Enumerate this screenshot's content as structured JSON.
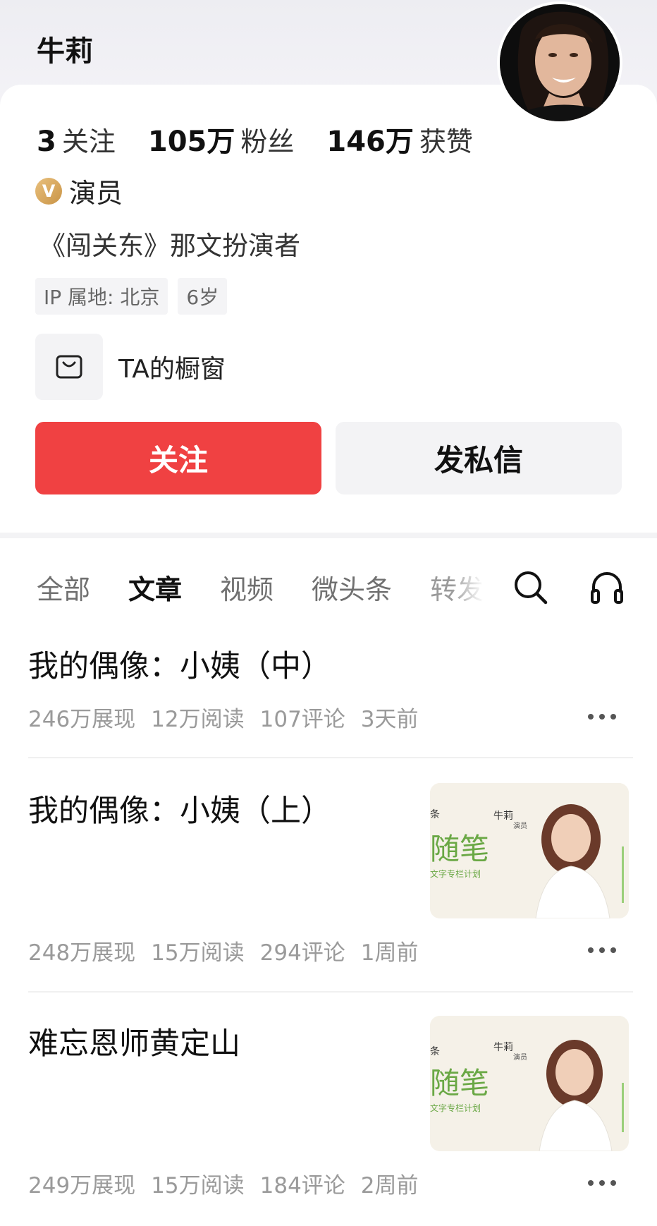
{
  "profile": {
    "name": "牛莉",
    "stats": [
      {
        "num": "3",
        "label": "关注"
      },
      {
        "num": "105万",
        "label": "粉丝"
      },
      {
        "num": "146万",
        "label": "获赞"
      }
    ],
    "verify_badge": "V",
    "verify_text": "演员",
    "bio": "《闯关东》那文扮演者",
    "tags": [
      "IP 属地: 北京",
      "6岁"
    ],
    "shop_label": "TA的橱窗",
    "follow_label": "关注",
    "message_label": "发私信"
  },
  "tabs": [
    "全部",
    "文章",
    "视频",
    "微头条",
    "转发"
  ],
  "active_tab": "文章",
  "articles": [
    {
      "title": "我的偶像：小姨（中）",
      "views": "246万展现",
      "reads": "12万阅读",
      "comments": "107评论",
      "time": "3天前"
    },
    {
      "title": "我的偶像：小姨（上）",
      "views": "248万展现",
      "reads": "15万阅读",
      "comments": "294评论",
      "time": "1周前",
      "thumb": {
        "brand": "条",
        "big": "随笔",
        "sub": "文字专栏计划",
        "name": "牛莉",
        "role": "演员"
      }
    },
    {
      "title": "难忘恩师黄定山",
      "views": "249万展现",
      "reads": "15万阅读",
      "comments": "184评论",
      "time": "2周前",
      "thumb": {
        "brand": "条",
        "big": "随笔",
        "sub": "文字专栏计划",
        "name": "牛莉",
        "role": "演员"
      }
    }
  ],
  "colors": {
    "accent": "#f04142",
    "badge": "#d9a456"
  }
}
